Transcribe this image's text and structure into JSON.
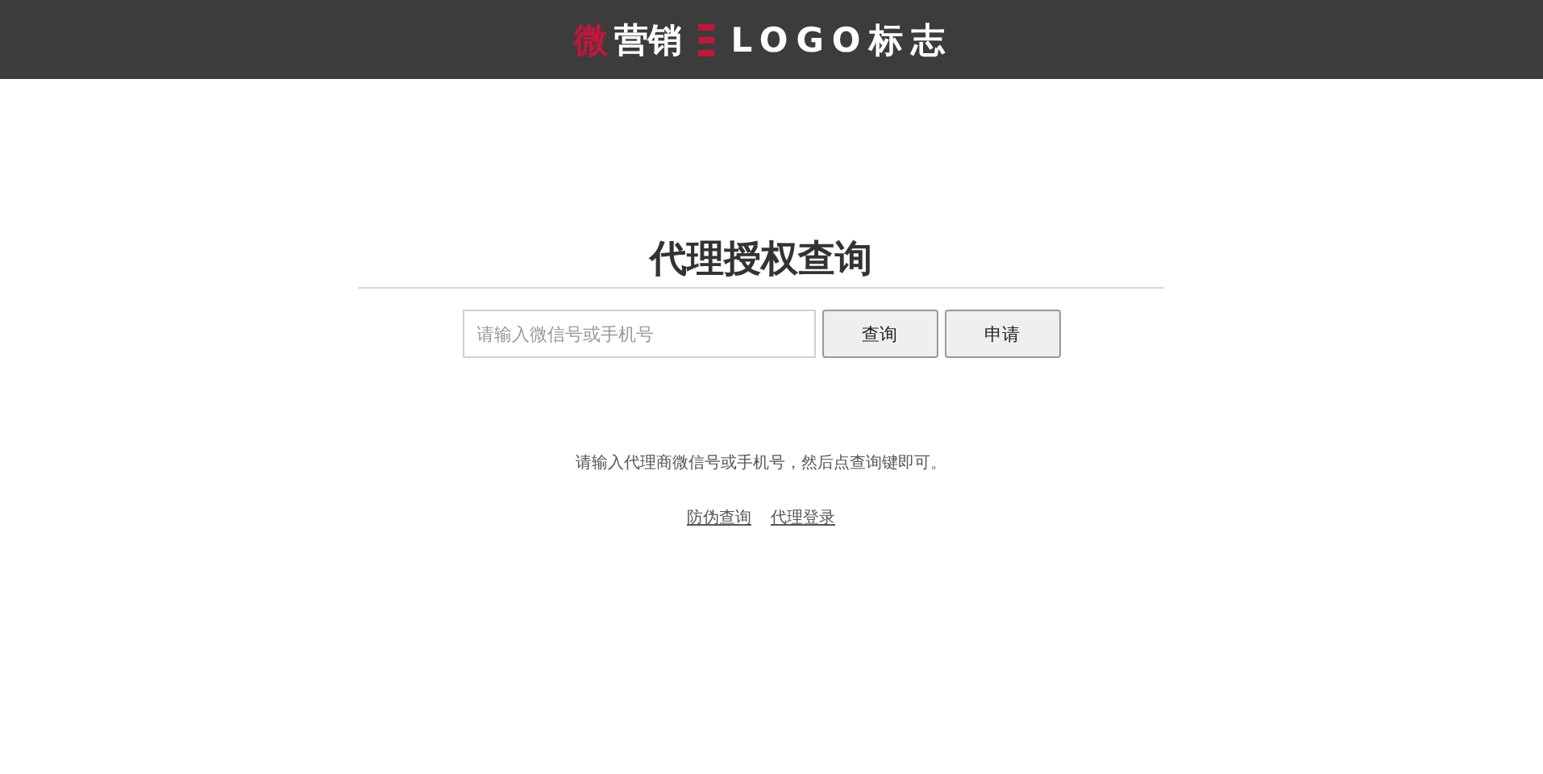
{
  "header": {
    "logo_mark": "微",
    "logo_text": "营销",
    "logo_suffix": "LOGO标志"
  },
  "title": "代理授权查询",
  "search": {
    "placeholder": "请输入微信号或手机号"
  },
  "buttons": [
    {
      "label": "查询"
    },
    {
      "label": "申请"
    }
  ],
  "hint": "请输入代理商微信号或手机号，然后点查询键即可。",
  "links": [
    {
      "label": "防伪查询"
    },
    {
      "label": "代理登录"
    }
  ]
}
